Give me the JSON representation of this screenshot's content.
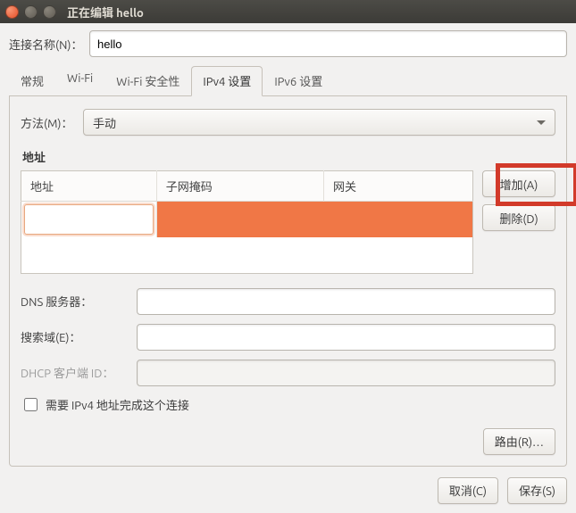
{
  "window": {
    "title": "正在编辑 hello"
  },
  "connectionName": {
    "label": "连接名称(N)：",
    "value": "hello"
  },
  "tabs": [
    {
      "label": "常规"
    },
    {
      "label": "Wi-Fi"
    },
    {
      "label": "Wi-Fi 安全性"
    },
    {
      "label": "IPv4 设置"
    },
    {
      "label": "IPv6 设置"
    }
  ],
  "activeTabIndex": 3,
  "method": {
    "label": "方法(M)：",
    "value": "手动"
  },
  "addresses": {
    "section_label": "地址",
    "columns": {
      "addr": "地址",
      "mask": "子网掩码",
      "gw": "网关"
    },
    "rows": [
      {
        "addr": "",
        "mask": "",
        "gw": "",
        "editing": true
      }
    ]
  },
  "buttons": {
    "add": "增加(A)",
    "delete": "删除(D)",
    "routes": "路由(R)…",
    "cancel": "取消(C)",
    "save": "保存(S)"
  },
  "dns": {
    "label": "DNS 服务器：",
    "value": ""
  },
  "searchDomains": {
    "label": "搜索域(E)：",
    "value": ""
  },
  "dhcpClientId": {
    "label": "DHCP 客户端 ID：",
    "value": ""
  },
  "requireIpv4": {
    "label": "需要 IPv4 地址完成这个连接",
    "checked": false
  }
}
